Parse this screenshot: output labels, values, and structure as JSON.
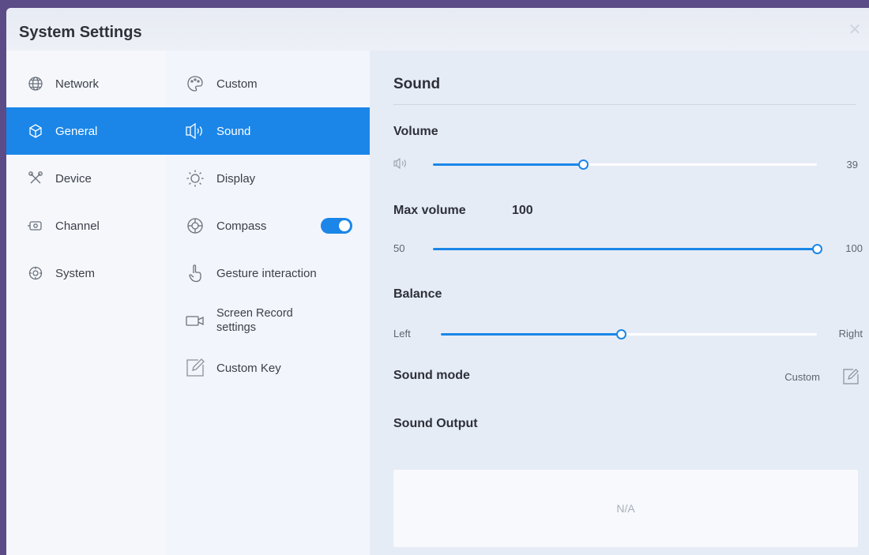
{
  "window": {
    "title": "System Settings",
    "close_symbol": "✕"
  },
  "sidebar": {
    "items": [
      {
        "label": "Network",
        "icon": "globe-icon",
        "active": false
      },
      {
        "label": "General",
        "icon": "cube-icon",
        "active": true
      },
      {
        "label": "Device",
        "icon": "tools-icon",
        "active": false
      },
      {
        "label": "Channel",
        "icon": "input-port-icon",
        "active": false
      },
      {
        "label": "System",
        "icon": "gear-icon",
        "active": false
      }
    ]
  },
  "submenu": {
    "items": [
      {
        "label": "Custom",
        "icon": "palette-icon",
        "active": false
      },
      {
        "label": "Sound",
        "icon": "speaker-icon",
        "active": true
      },
      {
        "label": "Display",
        "icon": "sun-icon",
        "active": false
      },
      {
        "label": "Compass",
        "icon": "compass-icon",
        "active": false
      },
      {
        "label": "Gesture interaction",
        "icon": "hand-icon",
        "active": false
      },
      {
        "label_line1": "Screen Record",
        "label_line2": "settings",
        "icon": "record-icon",
        "active": false
      },
      {
        "label": "Custom Key",
        "icon": "edit-icon",
        "active": false
      }
    ],
    "compass_toggle_on": true
  },
  "sound": {
    "title": "Sound",
    "volume": {
      "label": "Volume",
      "value": "39",
      "level": 0.39
    },
    "max_volume": {
      "label": "Max volume",
      "value": "100",
      "min_label": "50",
      "max_label": "100",
      "level": 1.0
    },
    "balance": {
      "label": "Balance",
      "left_label": "Left",
      "right_label": "Right",
      "level": 0.48
    },
    "sound_mode": {
      "label": "Sound mode",
      "value": "Custom"
    },
    "sound_output": {
      "label": "Sound Output",
      "value": "N/A"
    }
  },
  "colors": {
    "accent": "#1b86e8",
    "background": "#eef2f9"
  }
}
